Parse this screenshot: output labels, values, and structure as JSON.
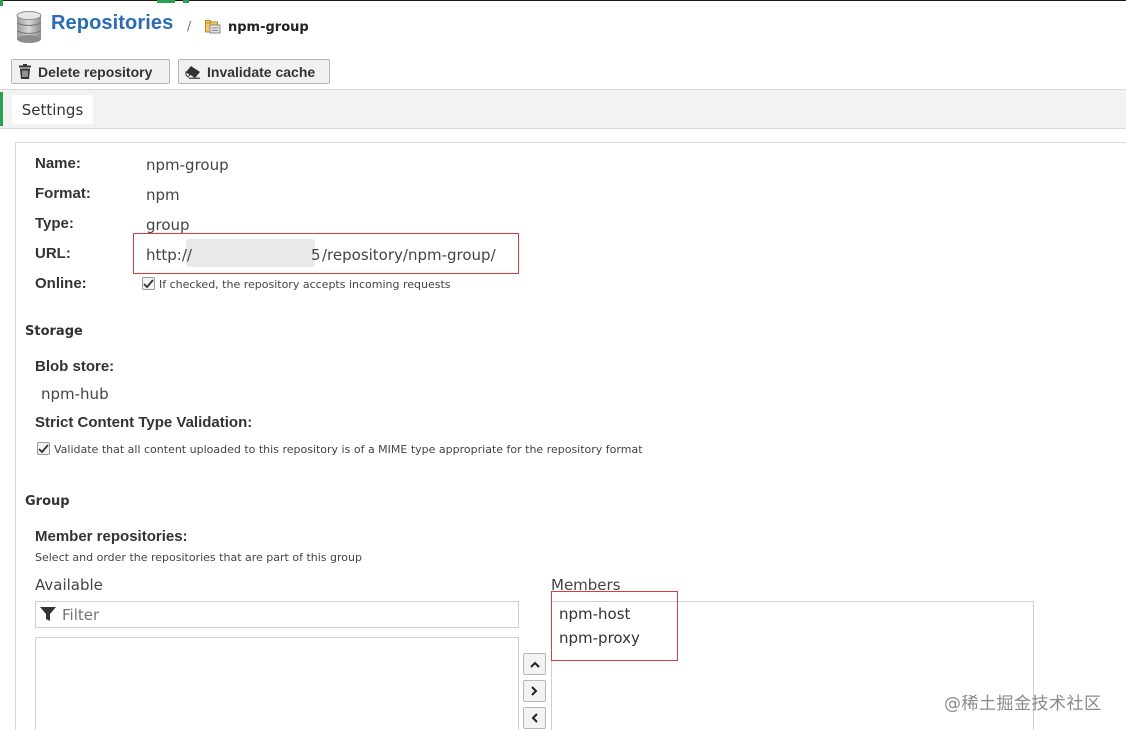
{
  "breadcrumb": {
    "title": "Repositories",
    "separator": "/",
    "repo": "npm-group"
  },
  "toolbar": {
    "delete_label": "Delete repository",
    "invalidate_label": "Invalidate cache"
  },
  "tabs": [
    {
      "label": "Settings",
      "active": true
    }
  ],
  "details": {
    "name_label": "Name:",
    "name_value": "npm-group",
    "format_label": "Format:",
    "format_value": "npm",
    "type_label": "Type:",
    "type_value": "group",
    "url_label": "URL:",
    "url_prefix": "http://",
    "url_redacted_tail": "5",
    "url_suffix": "/repository/npm-group/",
    "online_label": "Online:",
    "online_checked": true,
    "online_help": "If checked, the repository accepts incoming requests"
  },
  "storage": {
    "section_title": "Storage",
    "blob_store_label": "Blob store:",
    "blob_store_value": "npm-hub",
    "strict_label": "Strict Content Type Validation:",
    "strict_checked": true,
    "strict_help": "Validate that all content uploaded to this repository is of a MIME type appropriate for the repository format"
  },
  "group": {
    "section_title": "Group",
    "members_label": "Member repositories:",
    "members_help": "Select and order the repositories that are part of this group",
    "available_label": "Available",
    "filter_placeholder": "Filter",
    "members_title": "Members",
    "available": [],
    "members": [
      "npm-host",
      "npm-proxy"
    ]
  },
  "watermark": "@稀土掘金技术社区",
  "colors": {
    "link_blue": "#2a6cb3",
    "accent_green": "#2e9e4f",
    "highlight_red": "#e03a3a"
  }
}
